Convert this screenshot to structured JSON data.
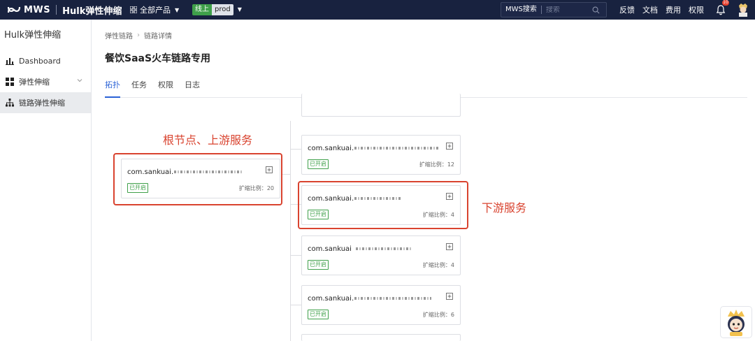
{
  "topbar": {
    "brand": "MWS",
    "app_name": "Hulk弹性伸缩",
    "products_label": "全部产品",
    "env_badge": "线上",
    "env_name": "prod",
    "search_label": "MWS搜索",
    "search_placeholder": "搜索",
    "links": [
      "反馈",
      "文档",
      "费用",
      "权限"
    ],
    "notification_count": "10"
  },
  "sidebar": {
    "title": "Hulk弹性伸缩",
    "items": [
      {
        "label": "Dashboard",
        "icon": "bar-chart-icon",
        "active": false
      },
      {
        "label": "弹性伸缩",
        "icon": "grid-icon",
        "active": false,
        "expandable": true
      },
      {
        "label": "链路弹性伸缩",
        "icon": "tree-icon",
        "active": true
      }
    ]
  },
  "breadcrumb": [
    "弹性链路",
    "链路详情"
  ],
  "page_title": "餐饮SaaS火车链路专用",
  "tabs": [
    {
      "label": "拓扑",
      "active": true
    },
    {
      "label": "任务",
      "active": false
    },
    {
      "label": "权限",
      "active": false
    },
    {
      "label": "日志",
      "active": false
    }
  ],
  "root_node": {
    "name": "com.sankuai.",
    "status": "已开启",
    "scale_label": "扩缩比例：",
    "scale_value": "20"
  },
  "downstream_nodes": [
    {
      "name": "com.sankuai.",
      "status": "已开启",
      "scale_label": "扩缩比例：",
      "scale_value": "12"
    },
    {
      "name": "com.sankuai.",
      "status": "已开启",
      "scale_label": "扩缩比例：",
      "scale_value": "4"
    },
    {
      "name": "com.sankuai",
      "status": "已开启",
      "scale_label": "扩缩比例：",
      "scale_value": "4"
    },
    {
      "name": "com.sankuai.",
      "status": "已开启",
      "scale_label": "扩缩比例：",
      "scale_value": "6"
    }
  ],
  "annotations": {
    "root": "根节点、上游服务",
    "downstream": "下游服务"
  },
  "colors": {
    "topbar_bg": "#18223f",
    "accent": "#2a62d6",
    "status_green": "#3fa04a",
    "annotation_red": "#d9432f"
  }
}
